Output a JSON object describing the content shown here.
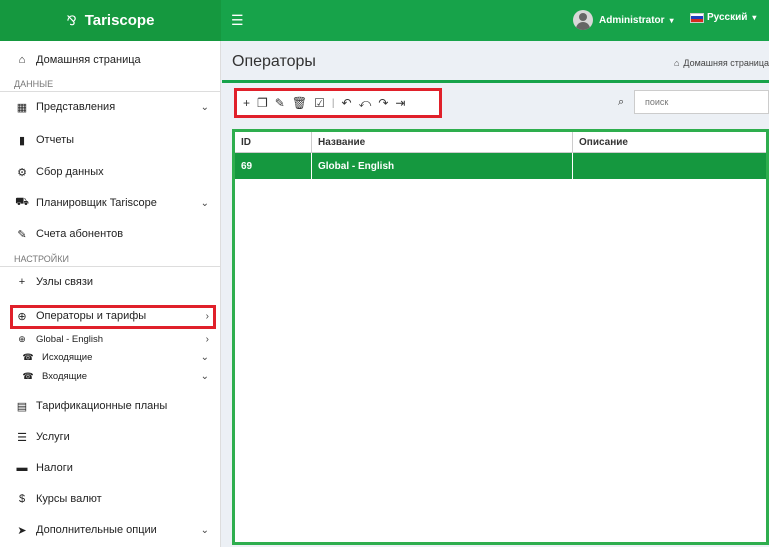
{
  "app": {
    "brand": "Tariscope",
    "user": "Administrator",
    "language": "Русский"
  },
  "sidebar": {
    "home": "Домашняя страница",
    "section_data": "ДАННЫЕ",
    "views": "Представления",
    "reports": "Отчеты",
    "data_collection": "Сбор данных",
    "scheduler": "Планировщик Tariscope",
    "subscriber_accounts": "Счета абонентов",
    "section_settings": "НАСТРОЙКИ",
    "nodes": "Узлы связи",
    "operators": "Операторы и тарифы",
    "operator_global": "Global - English",
    "outgoing": "Исходящие",
    "incoming": "Входящие",
    "tariff_plans": "Тарификационные планы",
    "services": "Услуги",
    "taxes": "Налоги",
    "currency": "Курсы валют",
    "extra": "Дополнительные опции"
  },
  "page": {
    "title": "Операторы",
    "breadcrumb": "Домашняя страница",
    "search_placeholder": "поиск"
  },
  "table": {
    "columns": [
      "ID",
      "Название",
      "Описание"
    ],
    "rows": [
      {
        "id": "69",
        "name": "Global - English",
        "description": ""
      }
    ]
  },
  "colors": {
    "accent": "#17a34a",
    "highlight_box": "#e0202a"
  }
}
